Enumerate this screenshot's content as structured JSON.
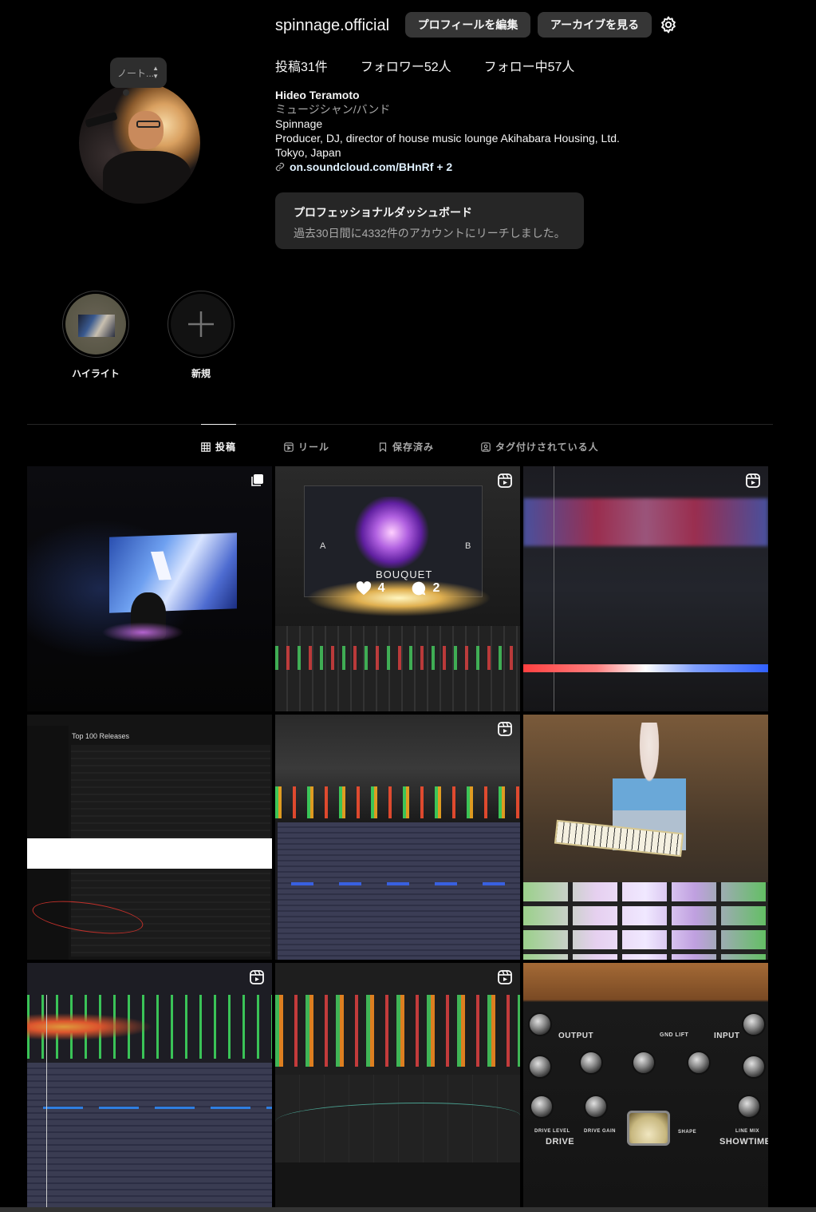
{
  "profile": {
    "username": "spinnage.official",
    "edit_button": "プロフィールを編集",
    "archive_button": "アーカイブを見る",
    "note_text": "ノート...",
    "stats": {
      "posts": "投稿31件",
      "followers": "フォロワー52人",
      "following": "フォロー中57人"
    },
    "bio": {
      "name": "Hideo Teramoto",
      "category": "ミュージシャン/バンド",
      "line1": "Spinnage",
      "line2": "Producer, DJ, director of house music lounge Akihabara Housing, Ltd.",
      "line3": "Tokyo, Japan",
      "link": "on.soundcloud.com/BHnRf + 2"
    },
    "dashboard": {
      "title": "プロフェッショナルダッシュボード",
      "subtitle": "過去30日間に4332件のアカウントにリーチしました。"
    }
  },
  "highlights": [
    {
      "label": "ハイライト"
    },
    {
      "label": "新規"
    }
  ],
  "tabs": [
    {
      "label": "投稿",
      "active": true
    },
    {
      "label": "リール",
      "active": false
    },
    {
      "label": "保存済み",
      "active": false
    },
    {
      "label": "タグ付けされている人",
      "active": false
    }
  ],
  "posts": [
    {
      "type": "carousel"
    },
    {
      "type": "reel",
      "hover": {
        "likes": "4",
        "comments": "2"
      },
      "screen_text": {
        "brand": "BOUQUET",
        "a": "A",
        "b": "B"
      }
    },
    {
      "type": "reel"
    },
    {
      "type": "image",
      "screen_text": {
        "title": "Top 100 Releases"
      }
    },
    {
      "type": "reel"
    },
    {
      "type": "image"
    },
    {
      "type": "reel"
    },
    {
      "type": "reel"
    },
    {
      "type": "image",
      "screen_text": {
        "output": "OUTPUT",
        "input": "INPUT",
        "gnd_lift": "GND LIFT",
        "drive": "DRIVE",
        "showtime": "SHOWTIME",
        "shape": "SHAPE",
        "drive_level": "DRIVE LEVEL",
        "drive_gain": "DRIVE GAIN",
        "line_mix": "LINE MIX"
      }
    }
  ],
  "colors": {
    "background": "#000000",
    "button": "#363636",
    "card": "#262626",
    "secondary_text": "#a8a8a8"
  }
}
